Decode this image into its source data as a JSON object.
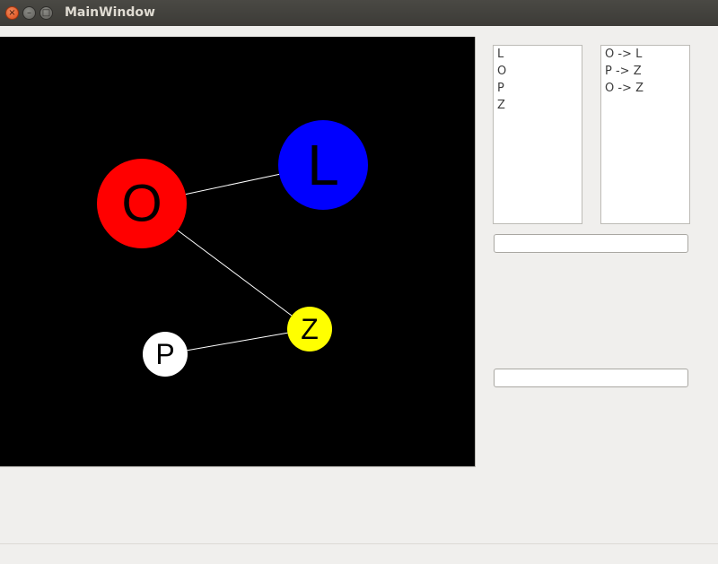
{
  "window": {
    "title": "MainWindow",
    "close_glyph": "×",
    "minimize_glyph": "–",
    "maximize_glyph": "□"
  },
  "graph": {
    "background": "#000000",
    "edge_color": "#ffffff",
    "nodes": [
      {
        "id": "O",
        "label": "O",
        "color": "#ff0000",
        "text_color": "#000000"
      },
      {
        "id": "L",
        "label": "L",
        "color": "#0000ff",
        "text_color": "#000000"
      },
      {
        "id": "P",
        "label": "P",
        "color": "#ffffff",
        "text_color": "#000000"
      },
      {
        "id": "Z",
        "label": "Z",
        "color": "#ffff00",
        "text_color": "#000000"
      }
    ],
    "edges": [
      {
        "from": "O",
        "to": "L"
      },
      {
        "from": "P",
        "to": "Z"
      },
      {
        "from": "O",
        "to": "Z"
      }
    ]
  },
  "node_list": {
    "items": [
      "L",
      "O",
      "P",
      "Z"
    ]
  },
  "edge_list": {
    "items": [
      "O -> L",
      "P -> Z",
      "O -> Z"
    ]
  },
  "input_top": {
    "value": ""
  },
  "input_bottom": {
    "value": ""
  }
}
